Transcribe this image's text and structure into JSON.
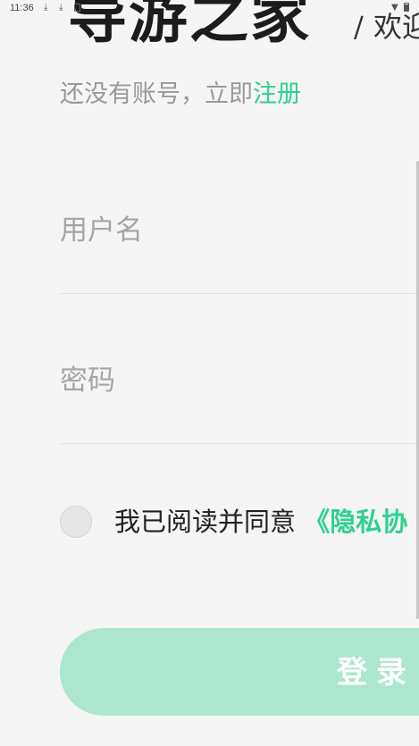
{
  "status_bar": {
    "time": "11:36",
    "icons": [
      "download-icon",
      "download-icon",
      "sim-card-icon",
      "wifi-icon",
      "battery-icon"
    ]
  },
  "header": {
    "title": "导游之家",
    "separator": "/",
    "welcome": "欢迎"
  },
  "register_prompt": {
    "text": "还没有账号，立即",
    "link": "注册"
  },
  "form": {
    "username_placeholder": "用户名",
    "username_value": "",
    "password_placeholder": "密码",
    "password_value": ""
  },
  "agreement": {
    "checked": false,
    "text": "我已阅读并同意",
    "link": "《隐私协"
  },
  "login_button": {
    "label": "登录"
  },
  "colors": {
    "accent": "#2fd08f",
    "button_bg": "#ace6cf",
    "background": "#f5f5f5"
  }
}
